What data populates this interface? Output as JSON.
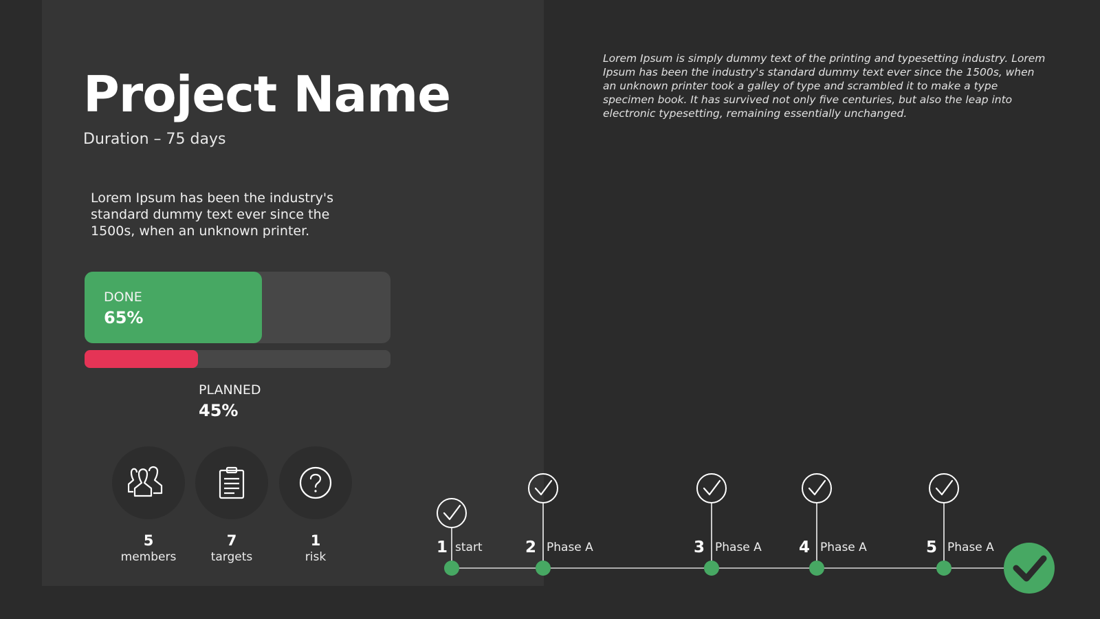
{
  "project": {
    "title": "Project Name",
    "duration": "Duration – 75 days",
    "intro": "Lorem Ipsum has been the industry's standard dummy text ever since the 1500s, when an unknown printer.",
    "description": "Lorem Ipsum is simply dummy text of the printing and typesetting industry. Lorem Ipsum has been the industry's standard dummy text ever since the 1500s, when an unknown printer took a galley of type and scrambled it to make a type specimen book. It has survived not only five centuries, but also the leap into electronic typesetting, remaining essentially unchanged."
  },
  "progress": {
    "done": {
      "label": "DONE",
      "value_text": "65%",
      "fraction": 0.58,
      "color": "#47a863"
    },
    "planned": {
      "label": "PLANNED",
      "value_text": "45%",
      "fraction": 0.37,
      "color": "#e53456"
    }
  },
  "stats": [
    {
      "number": "5",
      "label": "members",
      "icon": "users-icon"
    },
    {
      "number": "7",
      "label": "targets",
      "icon": "clipboard-icon"
    },
    {
      "number": "1",
      "label": "risk",
      "icon": "question-icon"
    }
  ],
  "timeline": {
    "milestones": [
      {
        "number": "1",
        "label": "start"
      },
      {
        "number": "2",
        "label": "Phase A"
      },
      {
        "number": "3",
        "label": "Phase A"
      },
      {
        "number": "4",
        "label": "Phase A"
      },
      {
        "number": "5",
        "label": "Phase A"
      }
    ],
    "accent": "#47a863",
    "end_icon": "check-icon"
  }
}
